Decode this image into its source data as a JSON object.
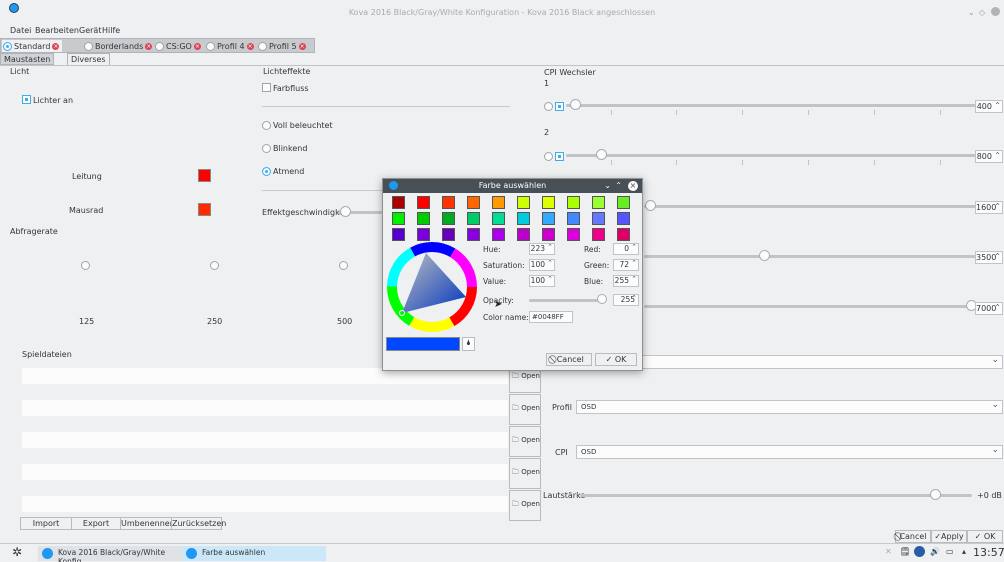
{
  "window": {
    "title": "Kova 2016 Black/Gray/White Konfiguration - Kova 2016 Black angeschlossen"
  },
  "menu": [
    "Datei",
    "Bearbeiten",
    "Gerät",
    "Hilfe"
  ],
  "profiles": [
    {
      "label": "Standard",
      "selected": true
    },
    {
      "label": "Borderlands",
      "selected": false
    },
    {
      "label": "CS:GO",
      "selected": false
    },
    {
      "label": "Profil 4",
      "selected": false
    },
    {
      "label": "Profil 5",
      "selected": false
    }
  ],
  "subtabs": [
    "Maustasten",
    "Diverses"
  ],
  "licht": {
    "heading": "Licht",
    "lichter_an": "Lichter an",
    "leitung": "Leitung",
    "mausrad": "Mausrad",
    "leitung_color": "#ff0000",
    "mausrad_color": "#ff2a00"
  },
  "lichteffekte": {
    "heading": "Lichteffekte",
    "farbfluss": "Farbfluss",
    "options": [
      "Voll beleuchtet",
      "Blinkend",
      "Atmend"
    ],
    "selected": "Atmend",
    "speed_label": "Effektgeschwindigkeit"
  },
  "abfragerate": {
    "heading": "Abfragerate",
    "options": [
      "125",
      "250",
      "500"
    ]
  },
  "cpi": {
    "heading": "CPI Wechsler",
    "levels": [
      {
        "num": "1",
        "value": "400"
      },
      {
        "num": "2",
        "value": "800"
      },
      {
        "num": "",
        "value": "1600"
      },
      {
        "num": "",
        "value": "3500"
      },
      {
        "num": "",
        "value": "7000"
      }
    ]
  },
  "spieldateien": {
    "heading": "Spieldateien",
    "open_label": "Open"
  },
  "sound": {
    "profil_label": "Profil",
    "profil_value": "OSD",
    "cpi_label": "CPI",
    "cpi_value": "OSD",
    "volume_label": "Lautstärke",
    "volume_value": "+0 dB"
  },
  "bottom_buttons": [
    "Import",
    "Export",
    "Umbenennen",
    "Zurücksetzen"
  ],
  "footer_buttons": [
    "Cancel",
    "Apply",
    "OK"
  ],
  "dialog": {
    "title": "Farbe auswählen",
    "hue_label": "Hue:",
    "hue": "223",
    "sat_label": "Saturation:",
    "sat": "100",
    "val_label": "Value:",
    "val": "100",
    "red_label": "Red:",
    "red": "0",
    "green_label": "Green:",
    "green": "72",
    "blue_label": "Blue:",
    "blue": "255",
    "opacity_label": "Opacity:",
    "opacity": "255",
    "colorname_label": "Color name:",
    "colorname": "#0048FF",
    "current_color": "#0048ff",
    "cancel": "Cancel",
    "ok": "OK",
    "palette": [
      [
        "#aa0000",
        "#ff0000",
        "#ff3300",
        "#ff6600",
        "#ff9900",
        "#ccff00",
        "#ddff00",
        "#aaff00",
        "#99ff33",
        "#66ee22"
      ],
      [
        "#00ee00",
        "#00cc00",
        "#00aa22",
        "#00cc66",
        "#00dd99",
        "#00ccdd",
        "#33aaff",
        "#4488ff",
        "#6677ff",
        "#5555ff"
      ],
      [
        "#5500cc",
        "#7700dd",
        "#6600bb",
        "#8800dd",
        "#aa00ee",
        "#bb00cc",
        "#cc00cc",
        "#dd00dd",
        "#ee0088",
        "#dd0066"
      ]
    ]
  },
  "taskbar": {
    "task1": "Kova 2016 Black/Gray/White Konfig",
    "task2": "Farbe auswählen",
    "clock": "13:57"
  }
}
